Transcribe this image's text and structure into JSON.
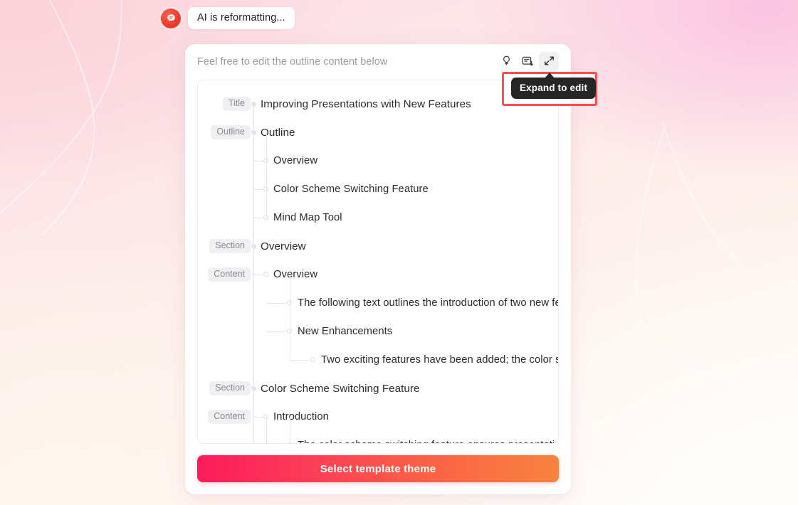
{
  "status": {
    "avatar_icon": "chat-bubble-icon",
    "message": "AI is reformatting..."
  },
  "card": {
    "hint": "Feel free to edit the outline content below",
    "actions": [
      {
        "name": "idea-lightbulb-icon",
        "label": ""
      },
      {
        "name": "format-outline-icon",
        "label": ""
      },
      {
        "name": "expand-arrows-icon",
        "label": ""
      }
    ],
    "footer_button": "Select template theme"
  },
  "tooltip": {
    "text": "Expand to edit",
    "highlight_color": "#ff4d4f"
  },
  "outline": {
    "rows": [
      {
        "badge": "Title",
        "level": 0,
        "text": "Improving Presentations with New Features"
      },
      {
        "badge": "Outline",
        "level": 0,
        "text": "Outline"
      },
      {
        "badge": "",
        "level": 1,
        "text": "Overview"
      },
      {
        "badge": "",
        "level": 1,
        "text": "Color Scheme Switching Feature"
      },
      {
        "badge": "",
        "level": 1,
        "text": "Mind Map Tool"
      },
      {
        "badge": "Section",
        "level": 0,
        "text": "Overview"
      },
      {
        "badge": "Content",
        "level": 1,
        "text": "Overview"
      },
      {
        "badge": "",
        "level": 2,
        "text": "The following text outlines the introduction of two new fea"
      },
      {
        "badge": "",
        "level": 2,
        "text": "New Enhancements"
      },
      {
        "badge": "",
        "level": 3,
        "text": "Two exciting features have been added; the color scher"
      },
      {
        "badge": "Section",
        "level": 0,
        "text": "Color Scheme Switching Feature"
      },
      {
        "badge": "Content",
        "level": 1,
        "text": "Introduction"
      },
      {
        "badge": "",
        "level": 2,
        "text": "The color scheme switching feature ensures presentations"
      }
    ]
  },
  "theme": {
    "accent_start": "#fb1b5a",
    "accent_end": "#f9833f",
    "badge_bg": "#f0f0f2",
    "tooltip_bg": "#262626"
  }
}
